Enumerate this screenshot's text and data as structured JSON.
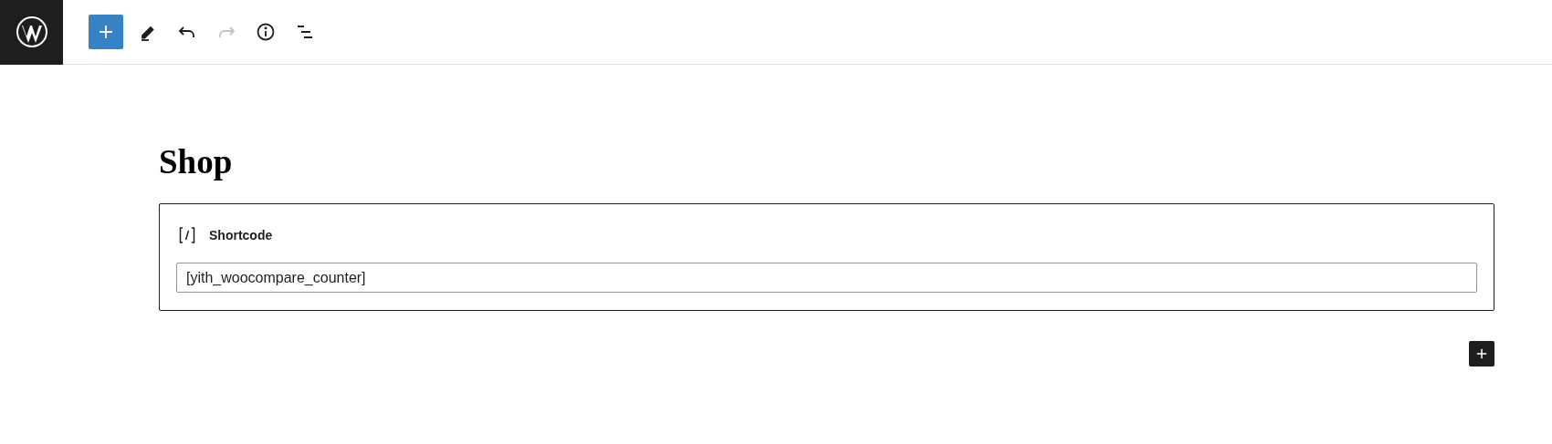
{
  "toolbar": {
    "tools": [
      {
        "kind": "inserter",
        "disabled": false
      },
      {
        "kind": "tools",
        "disabled": false
      },
      {
        "kind": "undo",
        "disabled": false
      },
      {
        "kind": "redo",
        "disabled": true
      },
      {
        "kind": "details",
        "disabled": false
      },
      {
        "kind": "outline",
        "disabled": false
      }
    ]
  },
  "page": {
    "title": "Shop",
    "block": {
      "label": "Shortcode",
      "value": "[yith_woocompare_counter]"
    }
  }
}
